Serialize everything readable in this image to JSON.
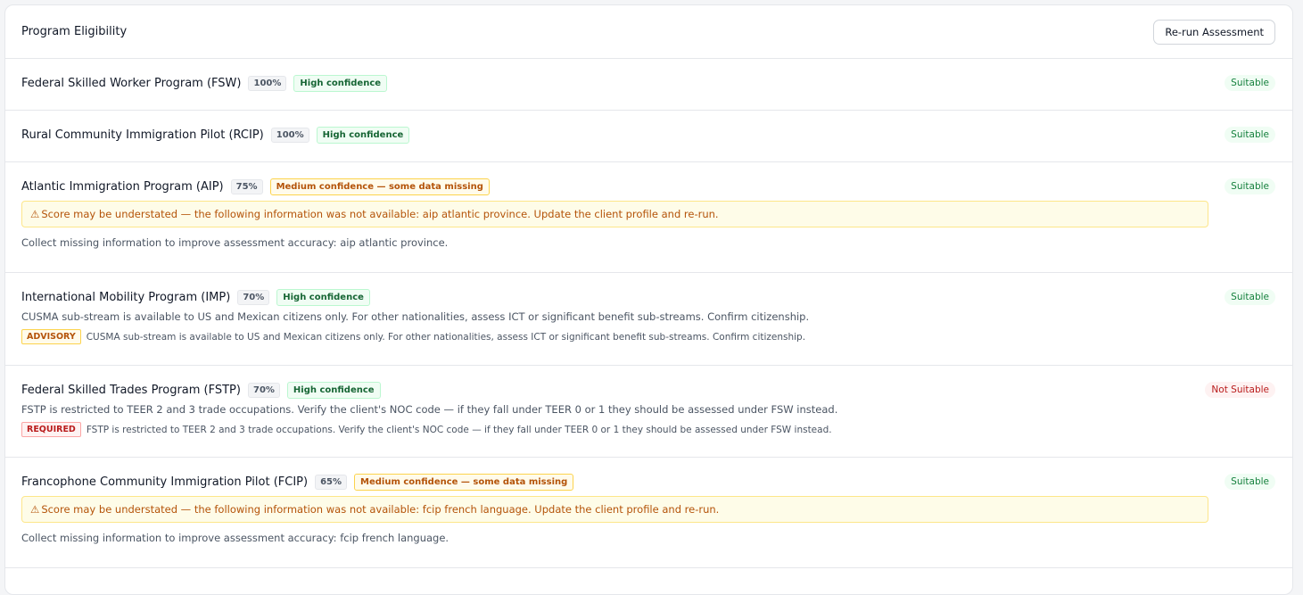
{
  "header": {
    "title": "Program Eligibility",
    "rerun_label": "Re-run Assessment"
  },
  "programs": [
    {
      "name": "Federal Skilled Worker Program (FSW)",
      "score": "100%",
      "confidence": "High confidence",
      "status": "Suitable"
    },
    {
      "name": "Rural Community Immigration Pilot (RCIP)",
      "score": "100%",
      "confidence": "High confidence",
      "status": "Suitable"
    },
    {
      "name": "Atlantic Immigration Program (AIP)",
      "score": "75%",
      "confidence": "Medium confidence — some data missing",
      "status": "Suitable",
      "warning_icon": "⚠",
      "warning": "Score may be understated — the following information was not available: aip atlantic province. Update the client profile and re-run.",
      "collect": "Collect missing information to improve assessment accuracy: aip atlantic province."
    },
    {
      "name": "International Mobility Program (IMP)",
      "score": "70%",
      "confidence": "High confidence",
      "status": "Suitable",
      "note": "CUSMA sub-stream is available to US and Mexican citizens only. For other nationalities, assess ICT or significant benefit sub-streams. Confirm citizenship.",
      "tag": "ADVISORY",
      "tag_text": "CUSMA sub-stream is available to US and Mexican citizens only. For other nationalities, assess ICT or significant benefit sub-streams. Confirm citizenship."
    },
    {
      "name": "Federal Skilled Trades Program (FSTP)",
      "score": "70%",
      "confidence": "High confidence",
      "status": "Not Suitable",
      "note": "FSTP is restricted to TEER 2 and 3 trade occupations. Verify the client's NOC code — if they fall under TEER 0 or 1 they should be assessed under FSW instead.",
      "tag": "REQUIRED",
      "tag_text": "FSTP is restricted to TEER 2 and 3 trade occupations. Verify the client's NOC code — if they fall under TEER 0 or 1 they should be assessed under FSW instead."
    },
    {
      "name": "Francophone Community Immigration Pilot (FCIP)",
      "score": "65%",
      "confidence": "Medium confidence — some data missing",
      "status": "Suitable",
      "warning_icon": "⚠",
      "warning": "Score may be understated — the following information was not available: fcip french language. Update the client profile and re-run.",
      "collect": "Collect missing information to improve assessment accuracy: fcip french language."
    }
  ],
  "colors": {
    "suitable": "#15803d",
    "not_suitable": "#b91c1c",
    "warning": "#b45309"
  }
}
